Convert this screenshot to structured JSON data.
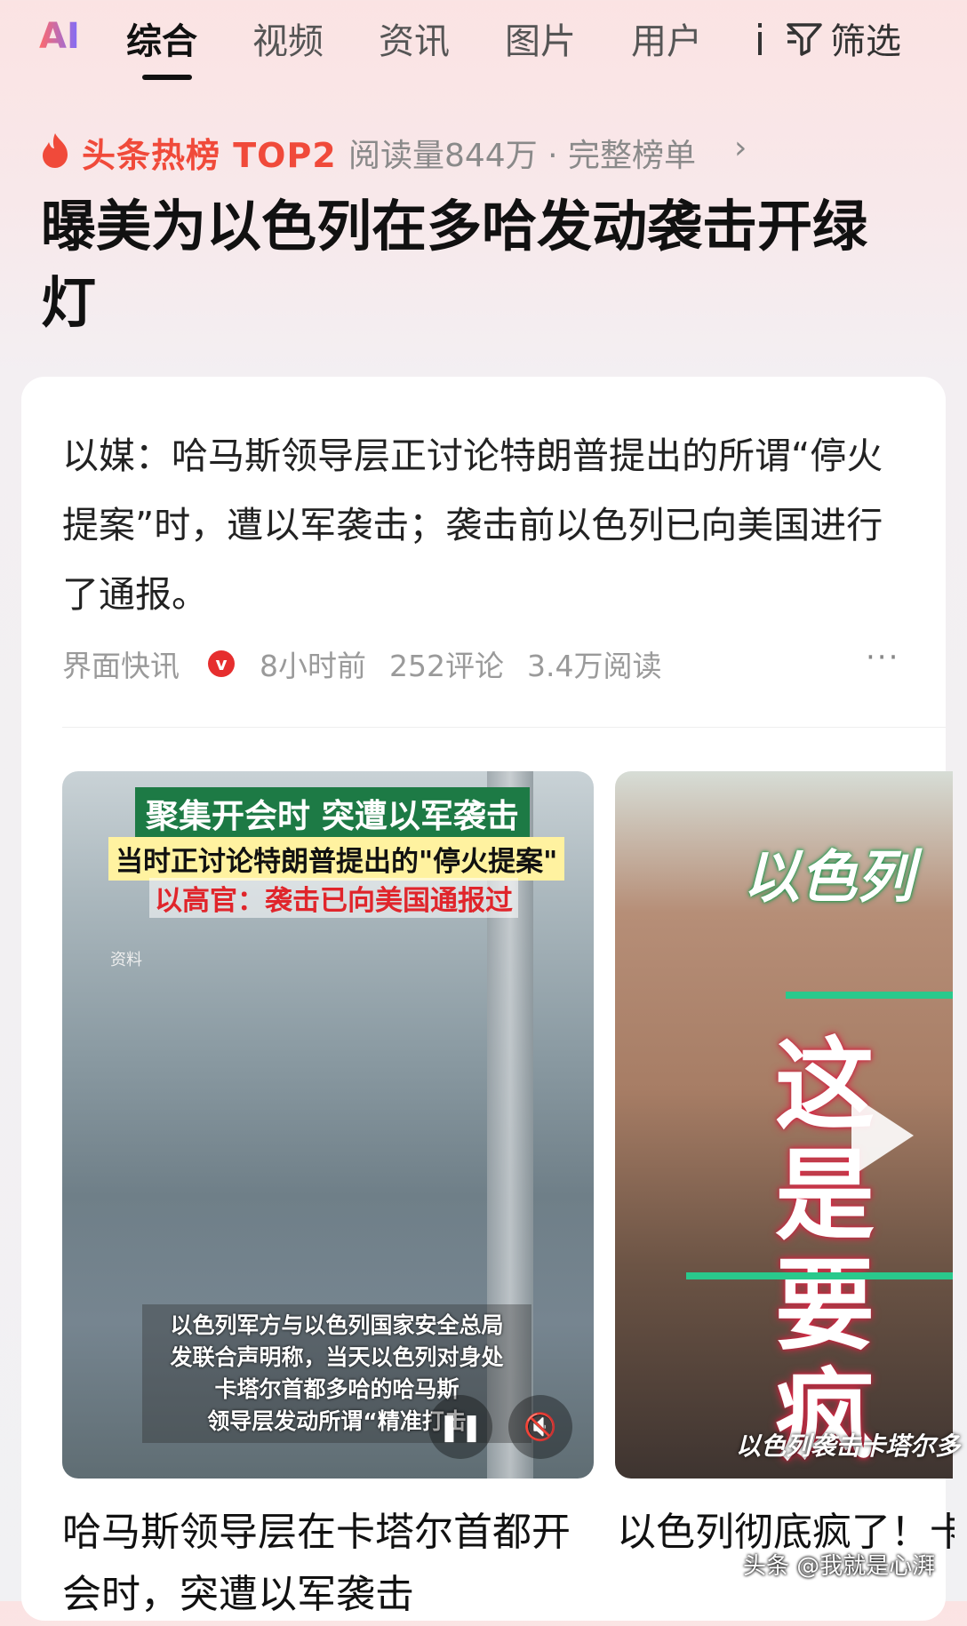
{
  "tabs": {
    "ai_label": "AI",
    "items": [
      {
        "label": "综合",
        "active": true
      },
      {
        "label": "视频",
        "active": false
      },
      {
        "label": "资讯",
        "active": false
      },
      {
        "label": "图片",
        "active": false
      },
      {
        "label": "用户",
        "active": false
      }
    ],
    "filter_label": "筛选"
  },
  "hot": {
    "label": "头条热榜 TOP2",
    "meta": "阅读量844万 · 完整榜单",
    "chevron": "›",
    "headline": "曝美为以色列在多哈发动袭击开绿灯"
  },
  "card": {
    "summary": "以媒：哈马斯领导层正讨论特朗普提出的所谓“停火提案”时，遭以军袭击；袭击前以色列已向美国进行了通报。",
    "source": "界面快讯",
    "verified_mark": "v",
    "time": "8小时前",
    "comments": "252评论",
    "reads": "3.4万阅读",
    "more": "···"
  },
  "video1": {
    "caption_green": "聚集开会时 突遭以军袭击",
    "caption_yellow": "当时正讨论特朗普提出的\"停火提案\"",
    "caption_red": "以高官：袭击已向美国通报过",
    "caption_small": "资料",
    "subtitles": [
      "以色列军方与以色列国家安全总局",
      "发联合声明称，当天以色列对身处",
      "卡塔尔首都多哈的哈马斯",
      "领导层发动所谓“精准打击"
    ],
    "pause_icon": "❚❚",
    "mute_icon": "🔇",
    "title": "哈马斯领导层在卡塔尔首都开会时，突遭以军袭击"
  },
  "video2": {
    "overlay_title": "以色列",
    "overlay_big_1": "这是",
    "overlay_big_2": "要疯",
    "overlay_bottom": "以色列袭击卡塔尔多",
    "title": "以色列彻底疯了！卡塔尔给炸了！特朗普"
  },
  "watermark": "头条 @我就是心湃",
  "colors": {
    "hot_red": "#f04a3a",
    "verified_red": "#e62e2e",
    "accent_green": "#29c98c"
  }
}
